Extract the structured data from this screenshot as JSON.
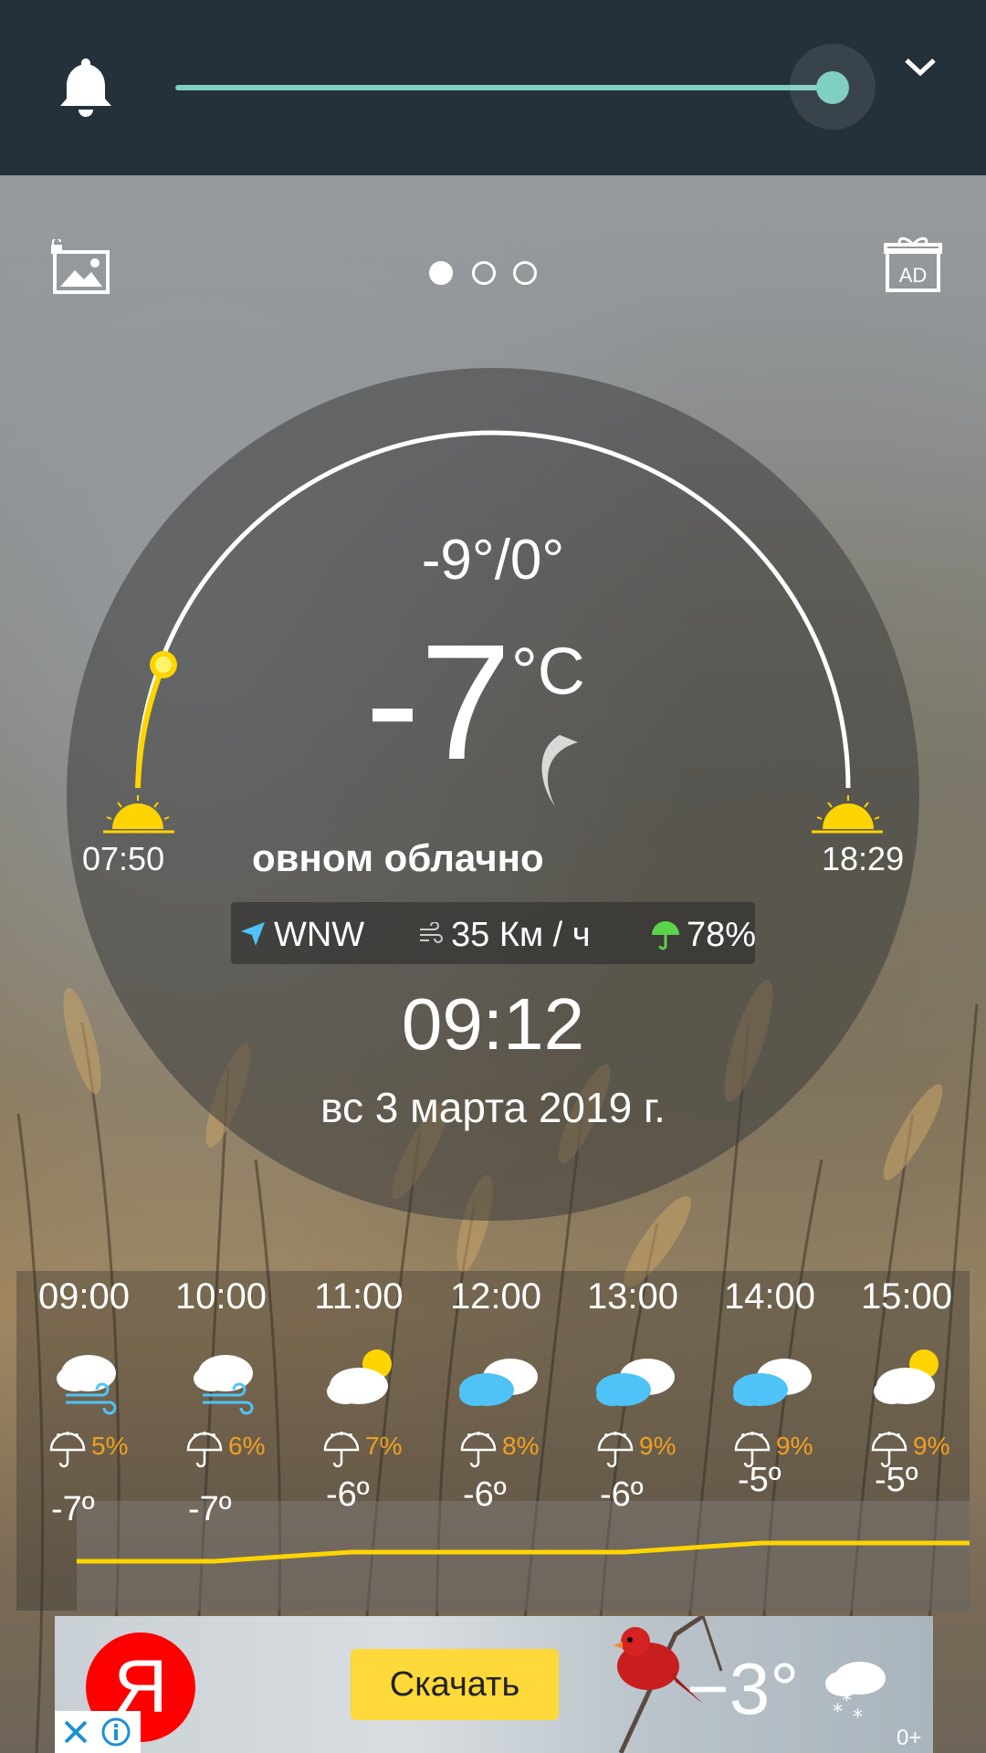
{
  "top_bar": {
    "bell_icon": "bell-icon",
    "slider_value": 1.0,
    "chevron_icon": "chevron-down-icon",
    "accent": "#7fcfc2"
  },
  "toolbar": {
    "wallpaper_icon": "image-lock-icon",
    "ad_icon": "gift-ad-icon",
    "ad_label": "AD",
    "pages": 3,
    "active_page": 0
  },
  "current": {
    "hilo": "-9°/0°",
    "temperature": "-7",
    "unit": "°C",
    "condition": "овном облачно",
    "sunrise": "07:50",
    "sunset": "18:29",
    "wind_dir": "WNW",
    "wind_speed": "35 Км / ч",
    "humidity": "78%",
    "time": "09:12",
    "date": "вс 3 марта 2019 г."
  },
  "hourly": [
    {
      "time": "09:00",
      "icon": "snow-wind-icon",
      "rain": "5%",
      "temp": "-7º",
      "t": -7
    },
    {
      "time": "10:00",
      "icon": "snow-wind-icon",
      "rain": "6%",
      "temp": "-7º",
      "t": -7
    },
    {
      "time": "11:00",
      "icon": "partly-sunny-icon",
      "rain": "7%",
      "temp": "-6º",
      "t": -6
    },
    {
      "time": "12:00",
      "icon": "cloudy-icon",
      "rain": "8%",
      "temp": "-6º",
      "t": -6
    },
    {
      "time": "13:00",
      "icon": "cloudy-icon",
      "rain": "9%",
      "temp": "-6º",
      "t": -6
    },
    {
      "time": "14:00",
      "icon": "cloudy-icon",
      "rain": "9%",
      "temp": "-5º",
      "t": -5
    },
    {
      "time": "15:00",
      "icon": "partly-sunny-icon",
      "rain": "9%",
      "temp": "-5º",
      "t": -5
    }
  ],
  "ad": {
    "logo": "Я",
    "button": "Скачать",
    "temp": "−3°",
    "age": "0+",
    "close_icon": "close-icon",
    "info_icon": "info-icon"
  },
  "colors": {
    "rain": "#f0a020",
    "sun": "#ffd400",
    "ad_button": "#ffd83a",
    "ad_logo": "#ff0000"
  }
}
